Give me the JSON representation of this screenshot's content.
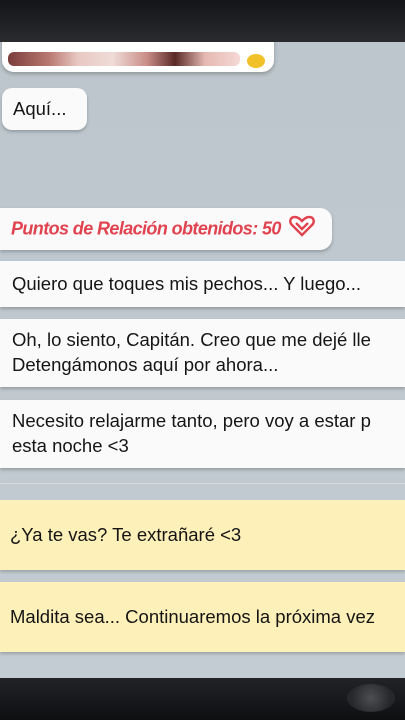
{
  "chat": {
    "messages": [
      {
        "text": "Aquí..."
      },
      {
        "text": "Quiero que toques mis pechos... Y luego..."
      },
      {
        "line1": "Oh, lo siento, Capitán. Creo que me dejé lle",
        "line2": "Detengámonos aquí por ahora..."
      },
      {
        "line1": "Necesito relajarme tanto, pero voy a estar p",
        "line2": "esta noche <3"
      }
    ],
    "relationship": {
      "text": "Puntos de Relación obtenidos: 50",
      "color": "#e0434f",
      "icon": "heart-icon"
    }
  },
  "choices": [
    {
      "label": "¿Ya te vas? Te extrañaré <3"
    },
    {
      "label": "Maldita sea... Continuaremos la próxima vez"
    }
  ],
  "colors": {
    "background": "#bfc8ce",
    "bubble": "#fafafa",
    "choice": "#fdf0b9",
    "accent": "#e0434f"
  }
}
